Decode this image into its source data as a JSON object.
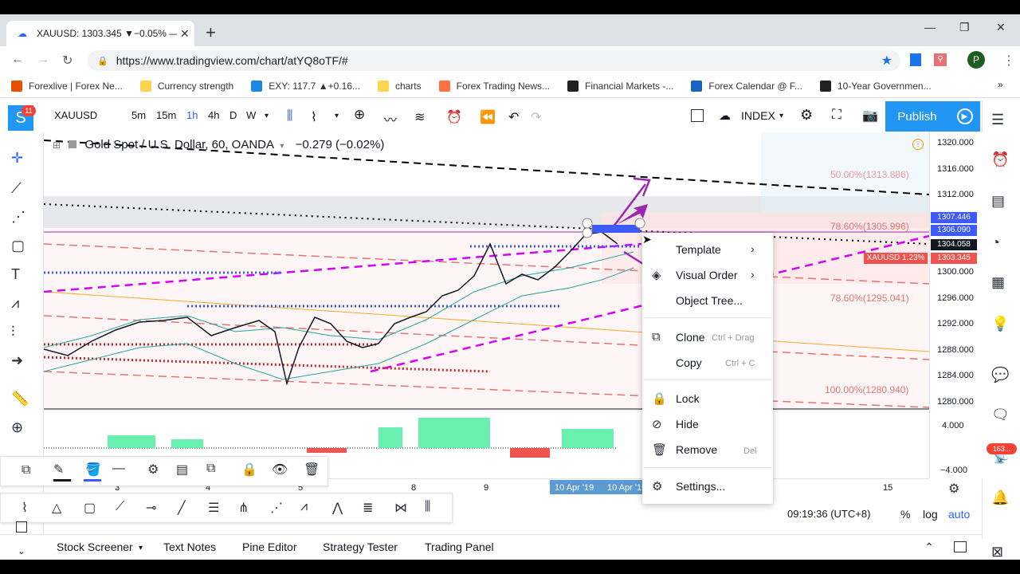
{
  "browser": {
    "tab_title": "XAUUSD: 1303.345 ▼−0.05% —",
    "url": "https://www.tradingview.com/chart/atYQ8oTF/#",
    "profile_initial": "P",
    "bookmarks": [
      {
        "label": "Forexlive | Forex Ne...",
        "color": "#e65100"
      },
      {
        "label": "Currency strength",
        "color": "#ffd54f"
      },
      {
        "label": "EXY: 117.7 ▲+0.16...",
        "color": "#1e88e5"
      },
      {
        "label": "charts",
        "color": "#ffd54f"
      },
      {
        "label": "Forex Trading News...",
        "color": "#ff7043"
      },
      {
        "label": "Financial Markets -...",
        "color": "#212121"
      },
      {
        "label": "Forex Calendar @ F...",
        "color": "#1565c0"
      },
      {
        "label": "10-Year Governmen...",
        "color": "#212121"
      }
    ]
  },
  "toolbar": {
    "badge": "11",
    "symbol": "XAUUSD",
    "intervals": [
      "5m",
      "15m",
      "1h",
      "4h",
      "D",
      "W"
    ],
    "selected_interval": "1h",
    "index_label": "INDEX",
    "publish_label": "Publish"
  },
  "chart": {
    "legend_title": "Gold Spot / U.S. Dollar, 60, OANDA",
    "legend_change": "−0.279 (−0.02%)",
    "price_levels": [
      "1320.000",
      "1316.000",
      "1312.000",
      "1307.446",
      "1306.090",
      "1304.058",
      "1303.345",
      "1300.000",
      "1296.000",
      "1292.000",
      "1288.000",
      "1284.000",
      "1280.000",
      "4.000",
      "−4.000"
    ],
    "price_label_current": "1303.345",
    "price_label_tag": "XAUUSD 1.23%",
    "fib_levels": [
      "50.00%(1313.886)",
      "78.60%(1305.996)",
      "78.60%(1295.041)",
      "100.00%(1280.940)"
    ],
    "time_labels": [
      "3",
      "4",
      "5",
      "8",
      "9",
      "15"
    ],
    "time_highlight": [
      "10 Apr '19",
      "10 Apr '19"
    ],
    "colors": {
      "accent": "#2196f3",
      "up": "#26a69a",
      "down": "#ef5350",
      "magenta": "#d500f9",
      "purple": "#9c27b0"
    }
  },
  "context_menu": {
    "items": [
      {
        "label": "Template",
        "shortcut": "",
        "submenu": true,
        "icon": ""
      },
      {
        "label": "Visual Order",
        "shortcut": "",
        "submenu": true,
        "icon": "layers-icon"
      },
      {
        "label": "Object Tree...",
        "shortcut": "",
        "submenu": false,
        "icon": ""
      },
      {
        "label": "Clone",
        "shortcut": "Ctrl + Drag",
        "submenu": false,
        "icon": "clone-icon"
      },
      {
        "label": "Copy",
        "shortcut": "Ctrl + C",
        "submenu": false,
        "icon": ""
      },
      {
        "label": "Lock",
        "shortcut": "",
        "submenu": false,
        "icon": "lock-icon"
      },
      {
        "label": "Hide",
        "shortcut": "",
        "submenu": false,
        "icon": "eye-off-icon"
      },
      {
        "label": "Remove",
        "shortcut": "Del",
        "submenu": false,
        "icon": "trash-icon"
      },
      {
        "label": "Settings...",
        "shortcut": "",
        "submenu": false,
        "icon": "gear-icon"
      }
    ]
  },
  "status": {
    "time": "09:19:36 (UTC+8)",
    "percent": "%",
    "log": "log",
    "auto": "auto",
    "notification_count": "163..."
  },
  "bottom_panel": {
    "tabs": [
      "Stock Screener",
      "Text Notes",
      "Pine Editor",
      "Strategy Tester",
      "Trading Panel"
    ]
  }
}
